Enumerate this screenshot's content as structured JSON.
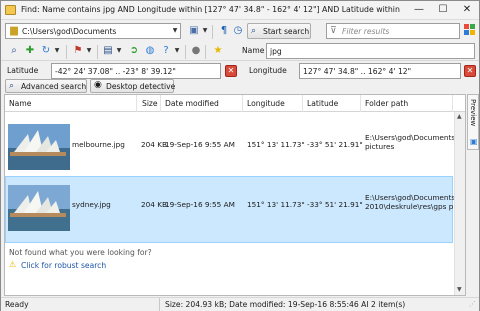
{
  "titlebar": {
    "title": "Find: Name contains jpg AND Longitude within [127° 47' 34.8\" - 162° 4' 12\"] AND Latitude within [-42° 2",
    "minimize": "—",
    "maximize": "☐",
    "close": "✕"
  },
  "toolbar": {
    "location": "C:\\Users\\god\\Documents",
    "start_search": "Start search",
    "filter_placeholder": "Filter results",
    "name_label": "Name",
    "name_value": "jpg"
  },
  "criteria": {
    "latitude_label": "Latitude",
    "latitude_value": "-42° 24' 37.08\" .. -23° 8' 39.12\"",
    "longitude_label": "Longitude",
    "longitude_value": "127° 47' 34.8\" .. 162° 4' 12\""
  },
  "actions": {
    "advanced_search": "Advanced search",
    "desktop_detective": "Desktop detective"
  },
  "columns": [
    "Name",
    "Size",
    "Date modified",
    "Longitude",
    "Latitude",
    "Folder path"
  ],
  "rows": [
    {
      "name": "melbourne.jpg",
      "size": "204 KB",
      "date": "19-Sep-16 9:55 AM",
      "longitude": "151° 13' 11.73\"",
      "latitude": "-33° 51' 21.91\"",
      "folder_lines": [
        "E:\\Users\\god\\Documents\\",
        "pictures"
      ],
      "selected": false
    },
    {
      "name": "sydney.jpg",
      "size": "204 KB",
      "date": "19-Sep-16 9:55 AM",
      "longitude": "151° 13' 11.73\"",
      "latitude": "-33° 51' 21.91\"",
      "folder_lines": [
        "E:\\Users\\god\\Documents\\",
        "2010\\deskrule\\res\\gps pict"
      ],
      "selected": true
    }
  ],
  "not_found": {
    "question": "Not found what you were looking for?",
    "link": "Click for robust search"
  },
  "preview_tab": "Preview",
  "status": {
    "left": "Ready",
    "center": "Size: 204.93 kB; Date modified: 19-Sep-16 8:55:46 AI 2 item(s)"
  },
  "icons": [
    "search-icon",
    "add-icon",
    "refresh-icon",
    "flag-icon",
    "save-icon",
    "nav-icon",
    "help-icon",
    "star-icon",
    "filter-icon",
    "folder-icon"
  ],
  "colors": {
    "selection": "#cce8ff",
    "clear_button": "#d84a3a",
    "link_warning": "#e8b100"
  }
}
